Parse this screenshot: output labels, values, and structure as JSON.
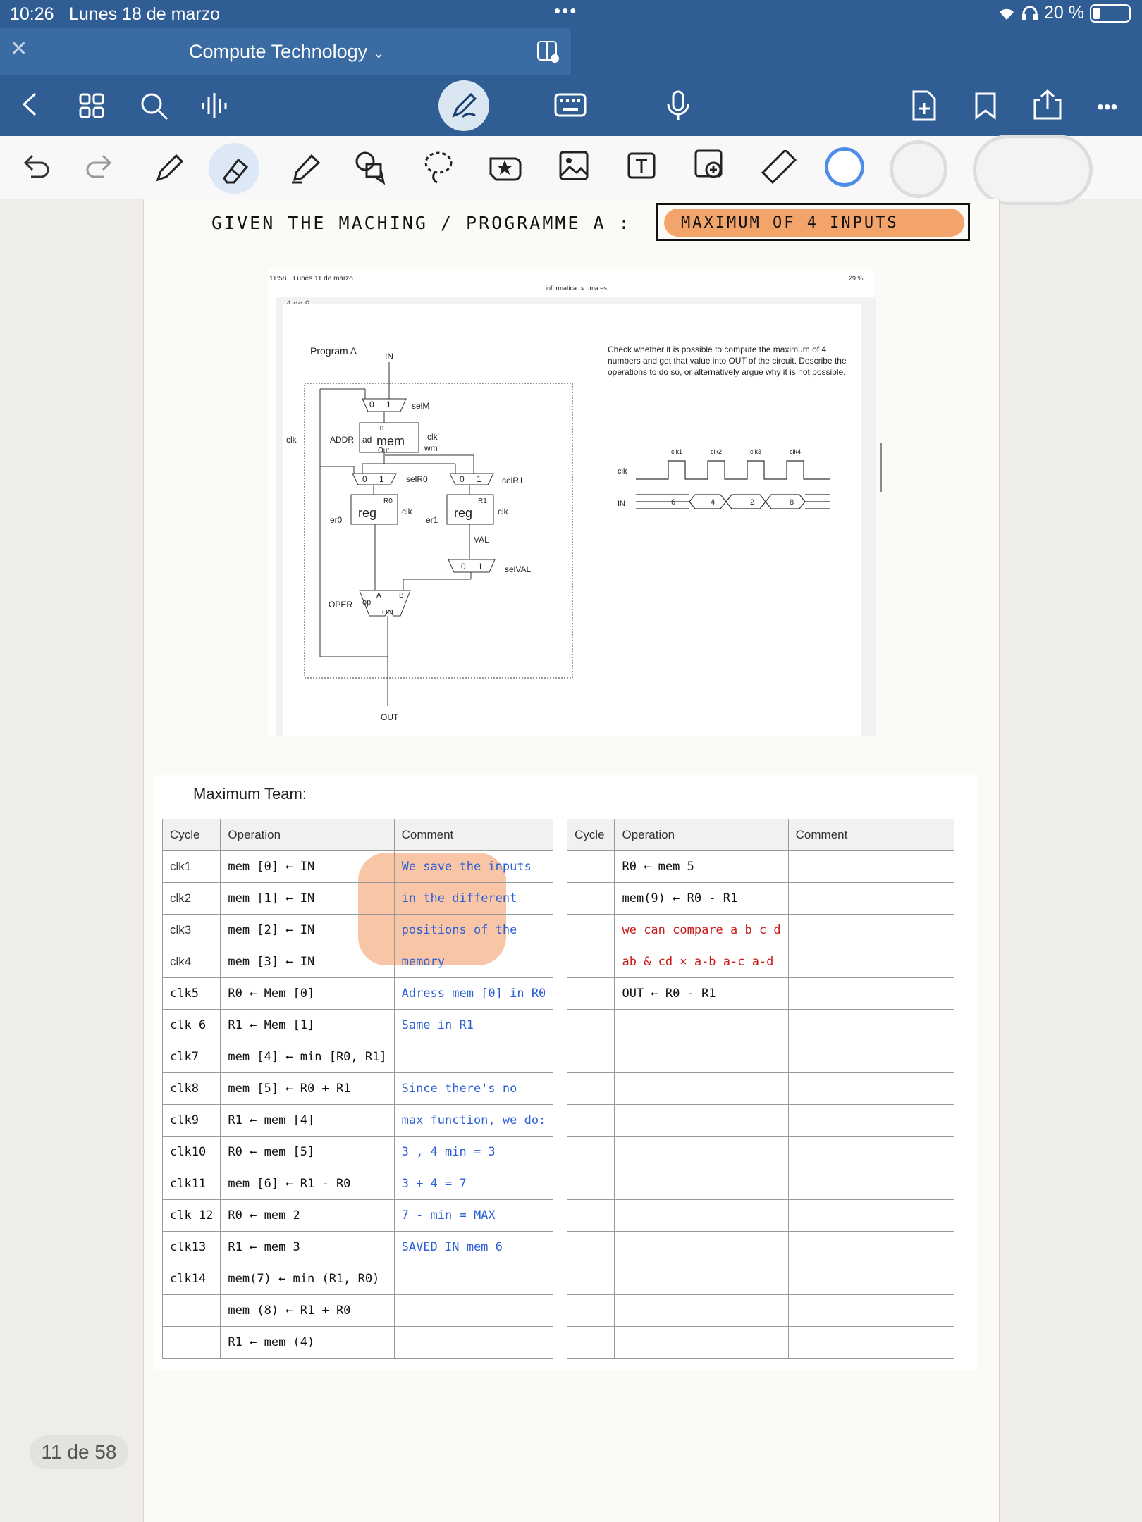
{
  "status": {
    "time": "10:26",
    "date": "Lunes 18 de marzo",
    "dots": "•••",
    "battery": "20 %"
  },
  "tab": {
    "title": "Compute Technology"
  },
  "page_counter": "11 de 58",
  "handwriting": {
    "given": "GIVEN   THE   MACHING / PROGRAMME   A :",
    "boxed": "MAXIMUM  OF   4  INPUTS"
  },
  "screenshot": {
    "status_time": "11:58",
    "status_date": "Lunes 11 de marzo",
    "url": "informatica.cv.uma.es",
    "battery": "29 %",
    "page_label": "4 de 9",
    "program_title": "Program A",
    "question": "Check whether it is possible to compute the maximum of 4 numbers and get that value into OUT of the circuit. Describe the operations to do so, or alternatively argue why it is not possible.",
    "labels": {
      "in": "IN",
      "out": "OUT",
      "selM": "selM",
      "clk": "clk",
      "wm": "wm",
      "addr": "ADDR",
      "ad": "ad",
      "mem": "mem",
      "mem_in": "In",
      "mem_out": "Out",
      "selR0": "selR0",
      "selR1": "selR1",
      "reg": "reg",
      "r0": "R0",
      "r1": "R1",
      "er0": "er0",
      "er1": "er1",
      "val": "VAL",
      "selVAL": "selVAL",
      "oper": "OPER",
      "op": "op",
      "a": "A",
      "b": "B",
      "alu_out": "Out",
      "zero": "0",
      "one": "1"
    },
    "timing": {
      "clks": [
        "clk1",
        "clk2",
        "clk3",
        "clk4"
      ],
      "clk_label": "clk",
      "in_label": "IN",
      "values": [
        "6",
        "4",
        "2",
        "8"
      ]
    }
  },
  "team": "Maximum Team:",
  "table_headers": [
    "Cycle",
    "Operation",
    "Comment"
  ],
  "left_rows": [
    {
      "cycle": "clk1",
      "op": "mem [0] ← IN",
      "comment": "We save the inputs"
    },
    {
      "cycle": "clk2",
      "op": "mem [1] ← IN",
      "comment": "in the different"
    },
    {
      "cycle": "clk3",
      "op": "mem [2] ← IN",
      "comment": "positions of the"
    },
    {
      "cycle": "clk4",
      "op": "mem [3] ← IN",
      "comment": "memory"
    },
    {
      "cycle": "clk5",
      "op": "R0 ← Mem [0]",
      "comment": "Adress mem [0] in R0"
    },
    {
      "cycle": "clk 6",
      "op": "R1 ← Mem [1]",
      "comment": "Same in R1"
    },
    {
      "cycle": "clk7",
      "op": "mem [4] ← min [R0, R1]",
      "comment": ""
    },
    {
      "cycle": "clk8",
      "op": "mem [5] ← R0 + R1",
      "comment": "Since there's no"
    },
    {
      "cycle": "clk9",
      "op": "R1 ← mem [4]",
      "comment": "max function, we do:"
    },
    {
      "cycle": "clk10",
      "op": "R0 ← mem [5]",
      "comment": "3 , 4  min = 3"
    },
    {
      "cycle": "clk11",
      "op": "mem [6] ← R1 - R0",
      "comment": "3 + 4 = 7"
    },
    {
      "cycle": "clk 12",
      "op": "R0 ← mem 2",
      "comment": "7 - min = MAX"
    },
    {
      "cycle": "clk13",
      "op": "R1 ← mem 3",
      "comment": "SAVED IN mem 6"
    },
    {
      "cycle": "clk14",
      "op": "mem(7) ← min (R1, R0)",
      "comment": ""
    },
    {
      "cycle": "",
      "op": "mem (8) ← R1 + R0",
      "comment": ""
    },
    {
      "cycle": "",
      "op": "R1 ← mem (4)",
      "comment": ""
    }
  ],
  "right_rows": [
    {
      "op": "R0 ← mem 5"
    },
    {
      "op": "mem(9) ← R0 - R1"
    },
    {
      "op": "we can compare  a b c d"
    },
    {
      "op": "ab & cd  ⨯  a-b  a-c  a-d"
    },
    {
      "op": "OUT ← R0 - R1"
    }
  ]
}
